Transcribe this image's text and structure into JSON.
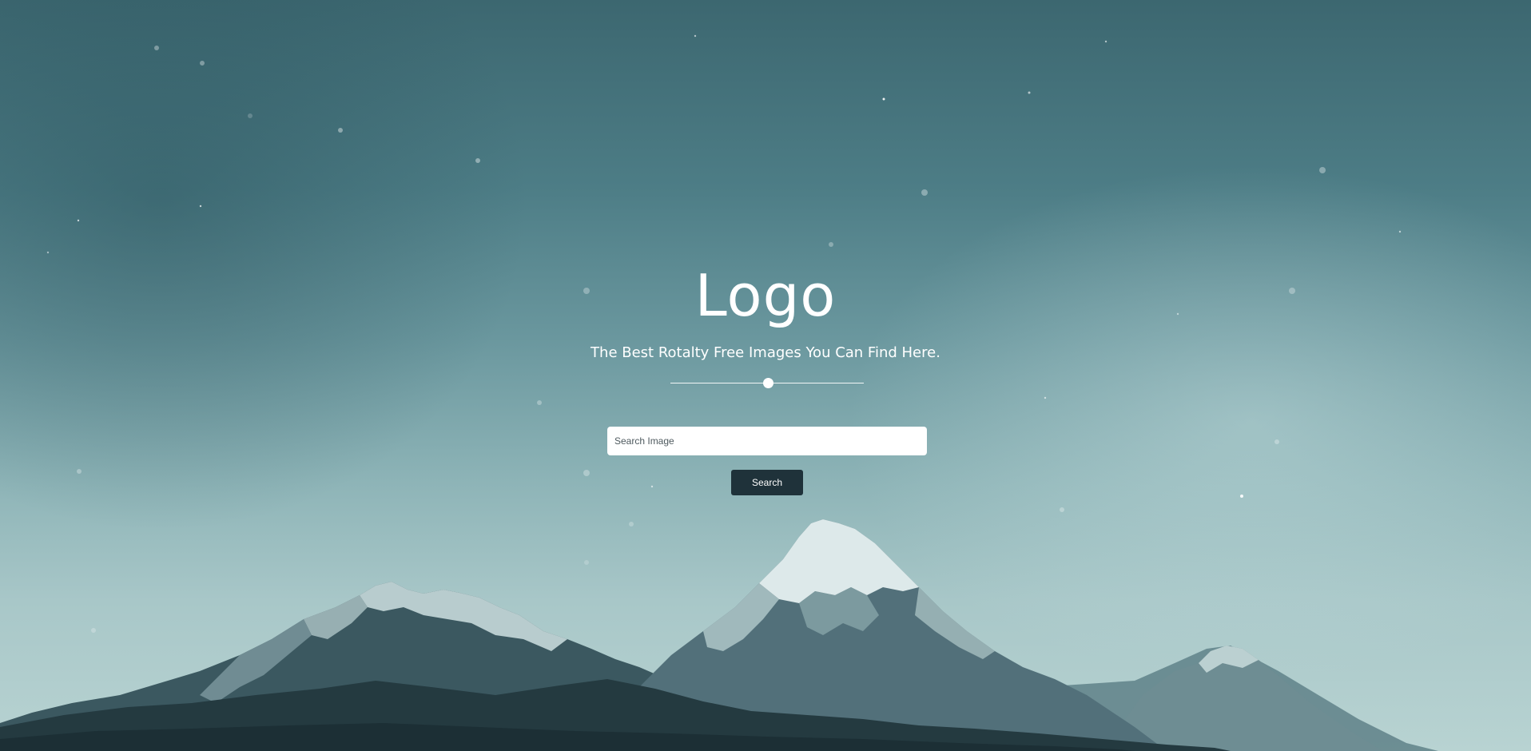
{
  "hero": {
    "logo": "Logo",
    "tagline": "The Best Rotalty Free Images You Can Find Here.",
    "background_image": "snowy-mountain-range-under-starry-teal-sky"
  },
  "search": {
    "placeholder": "Search Image",
    "value": "",
    "button_label": "Search"
  },
  "colors": {
    "sky_top": "#3c6770",
    "sky_bottom": "#b8d3d2",
    "button_bg": "#1f323a",
    "text": "#ffffff"
  }
}
